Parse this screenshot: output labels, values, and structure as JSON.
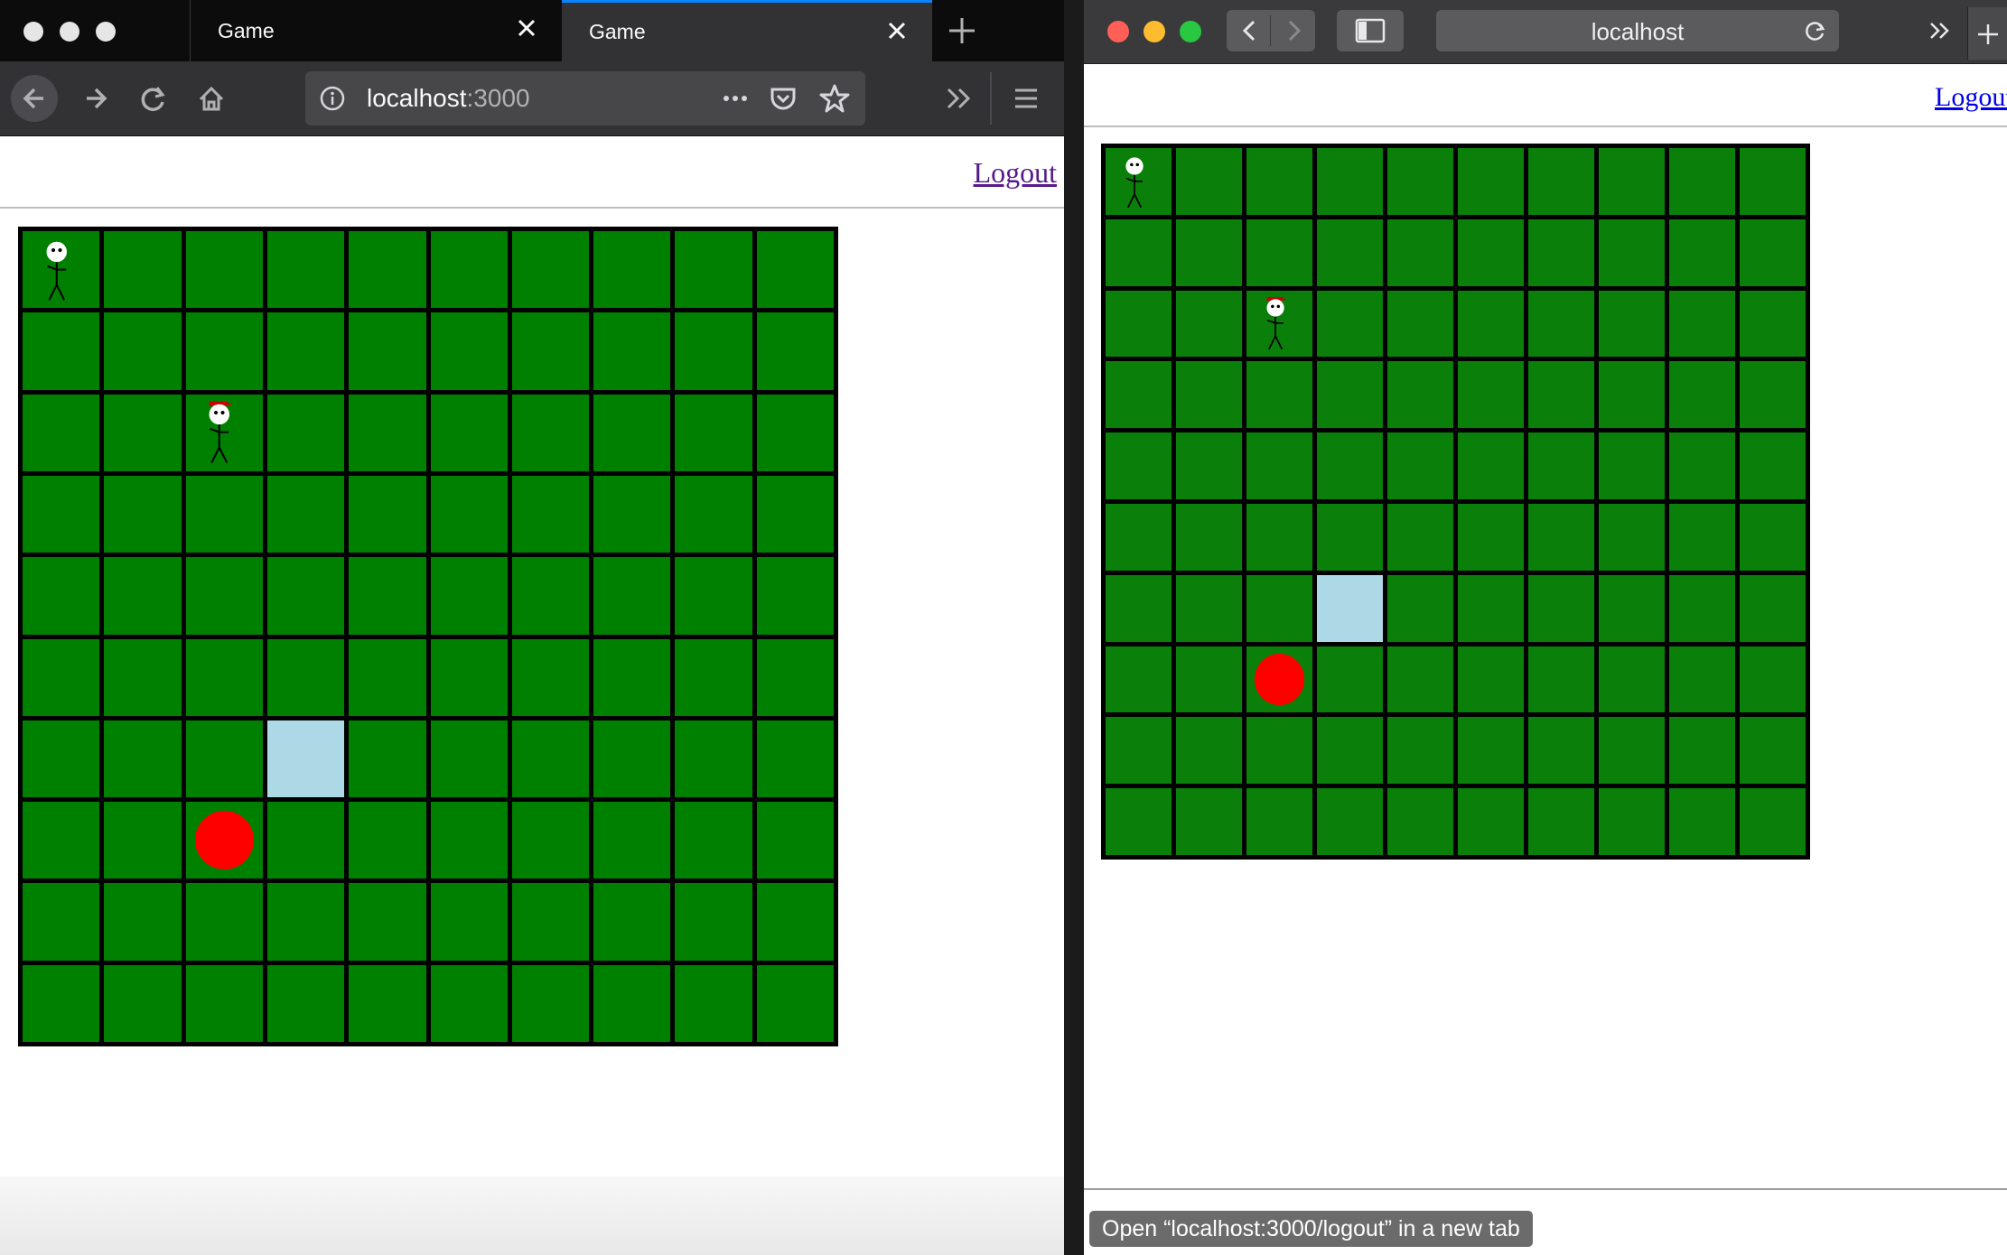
{
  "firefox": {
    "tabs": [
      {
        "label": "Game"
      },
      {
        "label": "Game"
      }
    ],
    "url": {
      "host": "localhost",
      "port": ":3000"
    },
    "logout_label": "Logout"
  },
  "safari": {
    "url": "localhost",
    "logout_label": "Logout",
    "status_text": "Open “localhost:3000/logout” in a new tab"
  },
  "game": {
    "rows": 10,
    "cols": 10,
    "grid_color": "#008000",
    "goal_color": "#add8e6",
    "ball_color": "#ff0000",
    "player_cell": {
      "row": 0,
      "col": 0
    },
    "opponent_cell": {
      "row": 2,
      "col": 2,
      "hat_color": "#cc0000"
    },
    "goal_cell": {
      "row": 6,
      "col": 3
    },
    "ball_cell": {
      "row": 7,
      "col": 2
    }
  }
}
